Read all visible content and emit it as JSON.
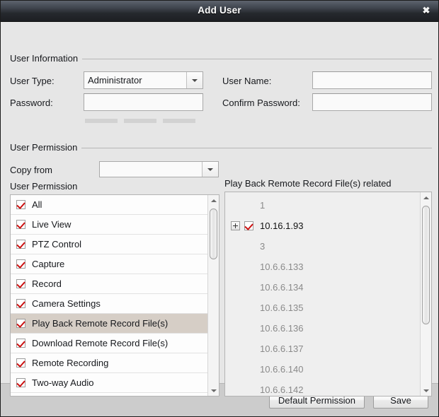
{
  "window": {
    "title": "Add User",
    "close_label": "✖"
  },
  "user_information": {
    "group_title": "User Information",
    "user_type_label": "User Type:",
    "user_type_value": "Administrator",
    "user_name_label": "User Name:",
    "user_name_value": "",
    "user_name_placeholder": "",
    "password_label": "Password:",
    "password_value": "",
    "password_placeholder": "",
    "confirm_password_label": "Confirm Password:",
    "confirm_password_value": "",
    "confirm_password_placeholder": "",
    "strength_bars": 3,
    "strength_bar_color": "#d2d2d2"
  },
  "user_permission": {
    "group_title": "User Permission",
    "copy_from_label": "Copy from",
    "copy_from_value": "",
    "left_list_title": "User Permission",
    "right_list_title": "Play Back Remote Record File(s) related",
    "selected_row_color": "#d6cec6",
    "check_color": "#cc1111",
    "permissions": [
      {
        "label": "All",
        "checked": true,
        "selected": false
      },
      {
        "label": "Live View",
        "checked": true,
        "selected": false
      },
      {
        "label": "PTZ Control",
        "checked": true,
        "selected": false
      },
      {
        "label": "Capture",
        "checked": true,
        "selected": false
      },
      {
        "label": "Record",
        "checked": true,
        "selected": false
      },
      {
        "label": "Camera Settings",
        "checked": true,
        "selected": false
      },
      {
        "label": "Play Back Remote Record File(s)",
        "checked": true,
        "selected": true
      },
      {
        "label": "Download Remote Record File(s)",
        "checked": true,
        "selected": false
      },
      {
        "label": "Remote Recording",
        "checked": true,
        "selected": false
      },
      {
        "label": "Two-way Audio",
        "checked": true,
        "selected": false
      }
    ],
    "devices": [
      {
        "label": "1",
        "expandable": false,
        "checkbox": false,
        "checked": false,
        "enabled": false
      },
      {
        "label": "10.16.1.93",
        "expandable": true,
        "checkbox": true,
        "checked": true,
        "enabled": true
      },
      {
        "label": "3",
        "expandable": false,
        "checkbox": false,
        "checked": false,
        "enabled": false
      },
      {
        "label": "10.6.6.133",
        "expandable": false,
        "checkbox": false,
        "checked": false,
        "enabled": false
      },
      {
        "label": "10.6.6.134",
        "expandable": false,
        "checkbox": false,
        "checked": false,
        "enabled": false
      },
      {
        "label": "10.6.6.135",
        "expandable": false,
        "checkbox": false,
        "checked": false,
        "enabled": false
      },
      {
        "label": "10.6.6.136",
        "expandable": false,
        "checkbox": false,
        "checked": false,
        "enabled": false
      },
      {
        "label": "10.6.6.137",
        "expandable": false,
        "checkbox": false,
        "checked": false,
        "enabled": false
      },
      {
        "label": "10.6.6.140",
        "expandable": false,
        "checkbox": false,
        "checked": false,
        "enabled": false
      },
      {
        "label": "10.6.6.142",
        "expandable": false,
        "checkbox": false,
        "checked": false,
        "enabled": false
      }
    ]
  },
  "footer": {
    "default_permission_label": "Default Permission",
    "save_label": "Save"
  }
}
